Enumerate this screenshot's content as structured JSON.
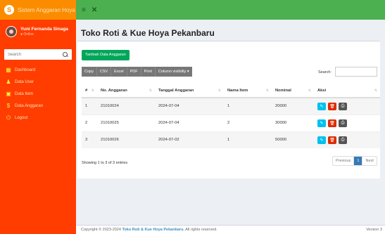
{
  "brand": {
    "logo": "S",
    "title": "Sistem Anggaran Hoya"
  },
  "user": {
    "name": "Yuni Fernanda Sinaga",
    "status": "● Online"
  },
  "sidebar": {
    "search_placeholder": "Search",
    "items": [
      {
        "label": "Dashboard",
        "icon": "grid-icon",
        "glyph": "▦"
      },
      {
        "label": "Data User",
        "icon": "user-icon",
        "glyph": "♟"
      },
      {
        "label": "Data Item",
        "icon": "box-icon",
        "glyph": "▣"
      },
      {
        "label": "Data Anggaran",
        "icon": "dollar-icon",
        "glyph": "$"
      },
      {
        "label": "Logout",
        "icon": "power-icon",
        "glyph": "⏻"
      }
    ]
  },
  "topbar": {
    "menu_glyph": "≡",
    "close_glyph": "✕"
  },
  "page": {
    "title": "Toko Roti & Kue Hoya Pekanbaru"
  },
  "actions": {
    "add_label": "Tambah Data Anggaran"
  },
  "tools": [
    "Copy",
    "CSV",
    "Excel",
    "PDF",
    "Print",
    "Column visibility ▾"
  ],
  "search_label": "Search:",
  "table": {
    "headers": [
      "#",
      "No. Anggaran",
      "Tanggal Anggaran",
      "Nama Item",
      "Nominal",
      "Aksi"
    ],
    "rows": [
      [
        "1",
        "21010024",
        "2024-07-04",
        "1",
        "20000"
      ],
      [
        "2",
        "21010025",
        "2024-07-04",
        "2",
        "30000"
      ],
      [
        "3",
        "21010026",
        "2024-07-02",
        "1",
        "50000"
      ]
    ],
    "action_glyphs": {
      "edit": "✎",
      "delete": "🗑",
      "print": "⎙"
    }
  },
  "info": "Showing 1 to 3 of 3 entries",
  "pager": [
    "Previous",
    "1",
    "Next"
  ],
  "footer": {
    "prefix": "Copyright © 2023-2024 ",
    "brand": "Toko Roti & Kue Hoya Pekanbaru.",
    "suffix": " All rights reserved.",
    "version": "Version 3"
  }
}
